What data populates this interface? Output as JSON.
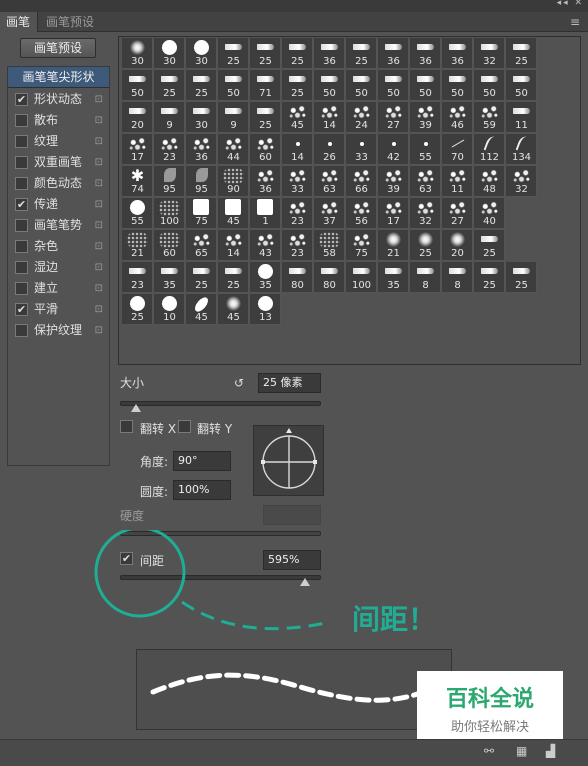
{
  "tabs": [
    {
      "label": "画笔"
    },
    {
      "label": "画笔预设"
    }
  ],
  "preset_button": "画笔预设",
  "sidebar": {
    "header": "画笔笔尖形状",
    "items": [
      {
        "label": "形状动态",
        "checked": true
      },
      {
        "label": "散布",
        "checked": false
      },
      {
        "label": "纹理",
        "checked": false
      },
      {
        "label": "双重画笔",
        "checked": false
      },
      {
        "label": "颜色动态",
        "checked": false
      },
      {
        "label": "传递",
        "checked": true
      },
      {
        "label": "画笔笔势",
        "checked": false
      },
      {
        "label": "杂色",
        "checked": false
      },
      {
        "label": "湿边",
        "checked": false
      },
      {
        "label": "建立",
        "checked": false
      },
      {
        "label": "平滑",
        "checked": true
      },
      {
        "label": "保护纹理",
        "checked": false
      }
    ]
  },
  "brushes": [
    [
      "30",
      "30",
      "30",
      "25",
      "25",
      "25",
      "36",
      "25",
      "36",
      "36",
      "36",
      "32",
      "25"
    ],
    [
      "50",
      "25",
      "25",
      "50",
      "71",
      "25",
      "50",
      "50",
      "50",
      "50",
      "50",
      "50",
      "50"
    ],
    [
      "20",
      "9",
      "30",
      "9",
      "25",
      "45",
      "14",
      "24",
      "27",
      "39",
      "46",
      "59",
      "11"
    ],
    [
      "17",
      "23",
      "36",
      "44",
      "60",
      "14",
      "26",
      "33",
      "42",
      "55",
      "70",
      "112",
      "134"
    ],
    [
      "74",
      "95",
      "95",
      "90",
      "36",
      "33",
      "63",
      "66",
      "39",
      "63",
      "11",
      "48",
      "32"
    ],
    [
      "55",
      "100",
      "75",
      "45",
      "1",
      "23",
      "37",
      "56",
      "17",
      "32",
      "27",
      "40"
    ],
    [
      "21",
      "60",
      "65",
      "14",
      "43",
      "23",
      "58",
      "75",
      "21",
      "25",
      "20",
      "25"
    ],
    [
      "23",
      "35",
      "25",
      "25",
      "35",
      "80",
      "80",
      "100",
      "35",
      "8",
      "8",
      "25",
      "25"
    ],
    [
      "25",
      "10",
      "45",
      "45",
      "13"
    ]
  ],
  "brush_icons": [
    [
      "soft",
      "hard",
      "hard",
      "tool",
      "tool",
      "tool",
      "tool",
      "tool",
      "tool",
      "tool",
      "tool",
      "tool",
      "tool"
    ],
    [
      "tool",
      "tool",
      "tool",
      "tool",
      "tool",
      "tool",
      "tool",
      "tool",
      "tool",
      "tool",
      "tool",
      "tool",
      "tool"
    ],
    [
      "tool",
      "tool",
      "tool",
      "tool",
      "tool",
      "splat",
      "splat",
      "splat",
      "splat",
      "splat",
      "splat",
      "splat",
      "tool"
    ],
    [
      "splat",
      "splat",
      "splat",
      "splat",
      "splat",
      "tiny",
      "tiny",
      "tiny",
      "tiny",
      "tiny",
      "line",
      "curve",
      "curve"
    ],
    [
      "star",
      "leaf",
      "leaf",
      "dots",
      "splat",
      "splat",
      "splat",
      "splat",
      "splat",
      "splat",
      "splat",
      "splat",
      "splat"
    ],
    [
      "hard",
      "dots",
      "square",
      "square",
      "square",
      "splat",
      "splat",
      "splat",
      "splat",
      "splat",
      "splat",
      "splat"
    ],
    [
      "dots",
      "dots",
      "splat",
      "splat",
      "splat",
      "splat",
      "dots",
      "splat",
      "soft",
      "soft",
      "soft",
      "tool"
    ],
    [
      "tool",
      "tool",
      "tool",
      "tool",
      "hard",
      "tool",
      "tool",
      "tool",
      "tool",
      "tool",
      "tool",
      "tool",
      "tool"
    ],
    [
      "hard",
      "hard",
      "ellipse",
      "soft",
      "hard"
    ]
  ],
  "size": {
    "label": "大小",
    "value": "25 像素",
    "level": 0.08
  },
  "flip_x": {
    "label": "翻转 X",
    "checked": false
  },
  "flip_y": {
    "label": "翻转 Y",
    "checked": false
  },
  "angle": {
    "label": "角度:",
    "value": "90°"
  },
  "roundness": {
    "label": "圆度:",
    "value": "100%"
  },
  "hardness": {
    "label": "硬度"
  },
  "spacing": {
    "label": "间距",
    "checked": true,
    "value": "595%",
    "level": 0.92
  },
  "annotation": "间距！",
  "watermark": {
    "title": "百科全说",
    "subtitle": "助你轻松解决"
  },
  "colors": {
    "accent": "#1fae94",
    "bg": "#535353",
    "selected": "#3e5a7a"
  }
}
